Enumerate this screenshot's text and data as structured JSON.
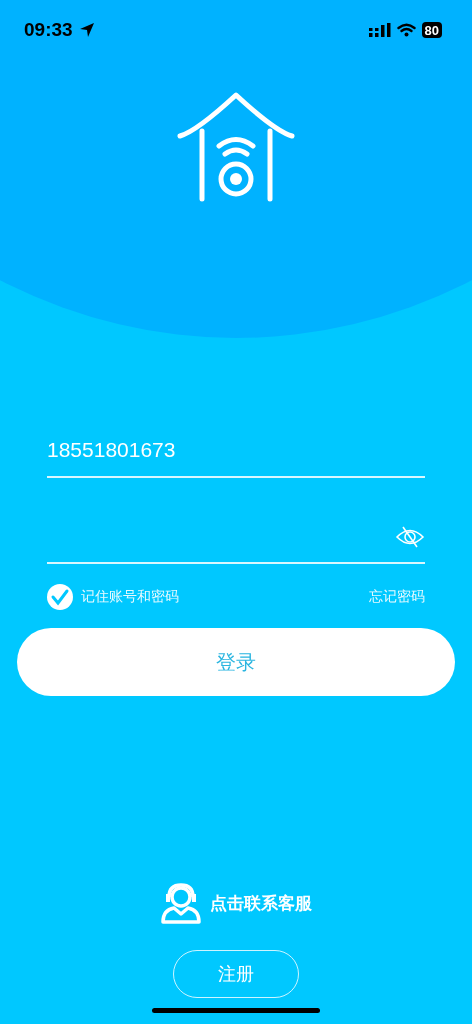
{
  "status_bar": {
    "time": "09:33",
    "battery": "80"
  },
  "login_form": {
    "phone": {
      "value": "18551801673"
    },
    "remember": {
      "label": "记住账号和密码",
      "checked": true
    },
    "forgot_link": "忘记密码",
    "login_button": "登录"
  },
  "support_link": "点击联系客服",
  "register_button": "注册"
}
